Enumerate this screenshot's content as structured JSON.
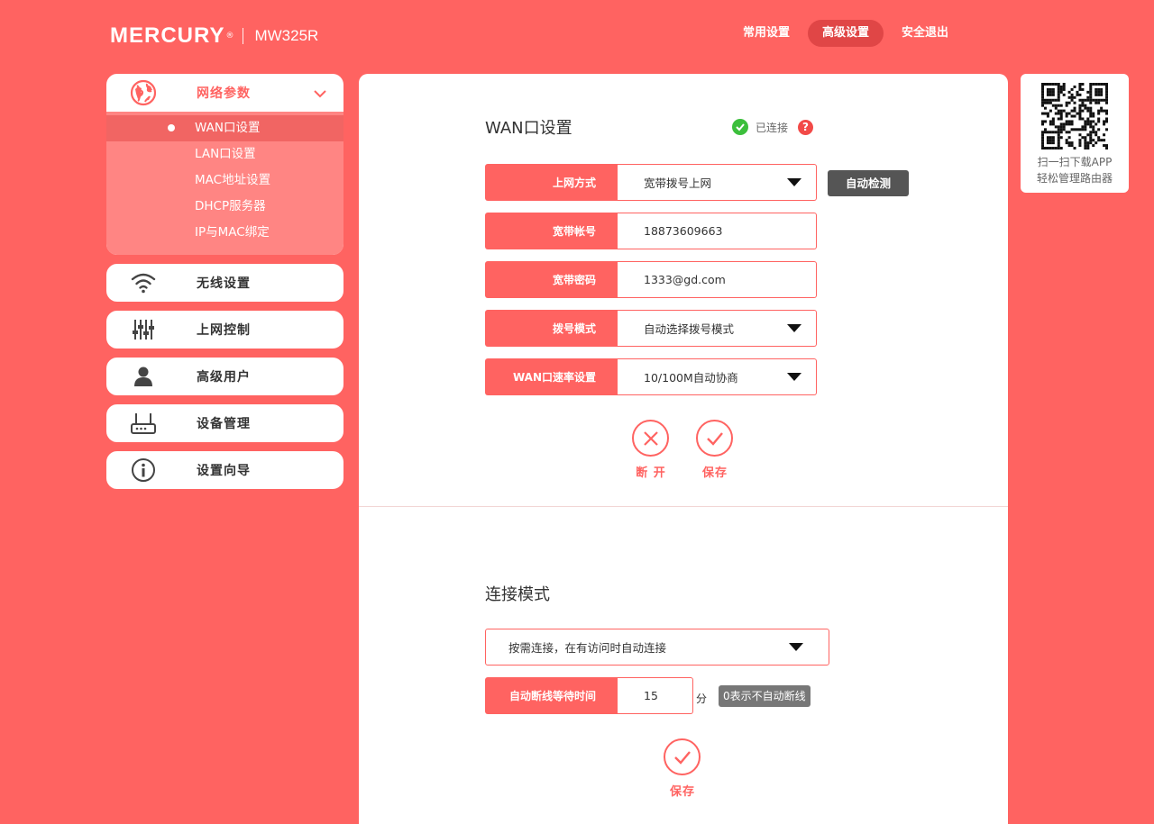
{
  "header": {
    "brand": "MERCURY",
    "reg_mark": "®",
    "model": "MW325R",
    "tabs": [
      {
        "label": "常用设置",
        "active": false
      },
      {
        "label": "高级设置",
        "active": true
      },
      {
        "label": "安全退出",
        "active": false
      }
    ]
  },
  "sidebar": {
    "network": {
      "label": "网络参数",
      "icon": "globe-icon",
      "expanded": true,
      "items": [
        {
          "label": "WAN口设置",
          "active": true
        },
        {
          "label": "LAN口设置",
          "active": false
        },
        {
          "label": "MAC地址设置",
          "active": false
        },
        {
          "label": "DHCP服务器",
          "active": false
        },
        {
          "label": "IP与MAC绑定",
          "active": false
        }
      ]
    },
    "groups": [
      {
        "label": "无线设置",
        "icon": "wifi-icon"
      },
      {
        "label": "上网控制",
        "icon": "sliders-icon"
      },
      {
        "label": "高级用户",
        "icon": "user-icon"
      },
      {
        "label": "设备管理",
        "icon": "router-icon"
      },
      {
        "label": "设置向导",
        "icon": "info-icon"
      }
    ]
  },
  "wan": {
    "title": "WAN口设置",
    "status": "已连接",
    "help": "?",
    "detect_button": "自动检测",
    "fields": {
      "conn_type": {
        "label": "上网方式",
        "value": "宽带拨号上网"
      },
      "account": {
        "label": "宽带帐号",
        "value": "18873609663"
      },
      "password": {
        "label": "宽带密码",
        "value": "1333@gd.com"
      },
      "dial_mode": {
        "label": "拨号模式",
        "value": "自动选择拨号模式"
      },
      "speed": {
        "label": "WAN口速率设置",
        "value": "10/100M自动协商"
      }
    },
    "disconnect_label": "断 开",
    "save_label": "保存"
  },
  "connect_mode": {
    "title": "连接模式",
    "mode_value": "按需连接，在有访问时自动连接",
    "idle_label": "自动断线等待时间",
    "idle_value": "15",
    "idle_unit": "分",
    "idle_tip": "0表示不自动断线",
    "save_label": "保存"
  },
  "qr": {
    "line1": "扫一扫下载APP",
    "line2": "轻松管理路由器"
  },
  "colors": {
    "brand": "#FF6361",
    "active_tab": "#E04646",
    "connected": "#3CBF3C"
  }
}
